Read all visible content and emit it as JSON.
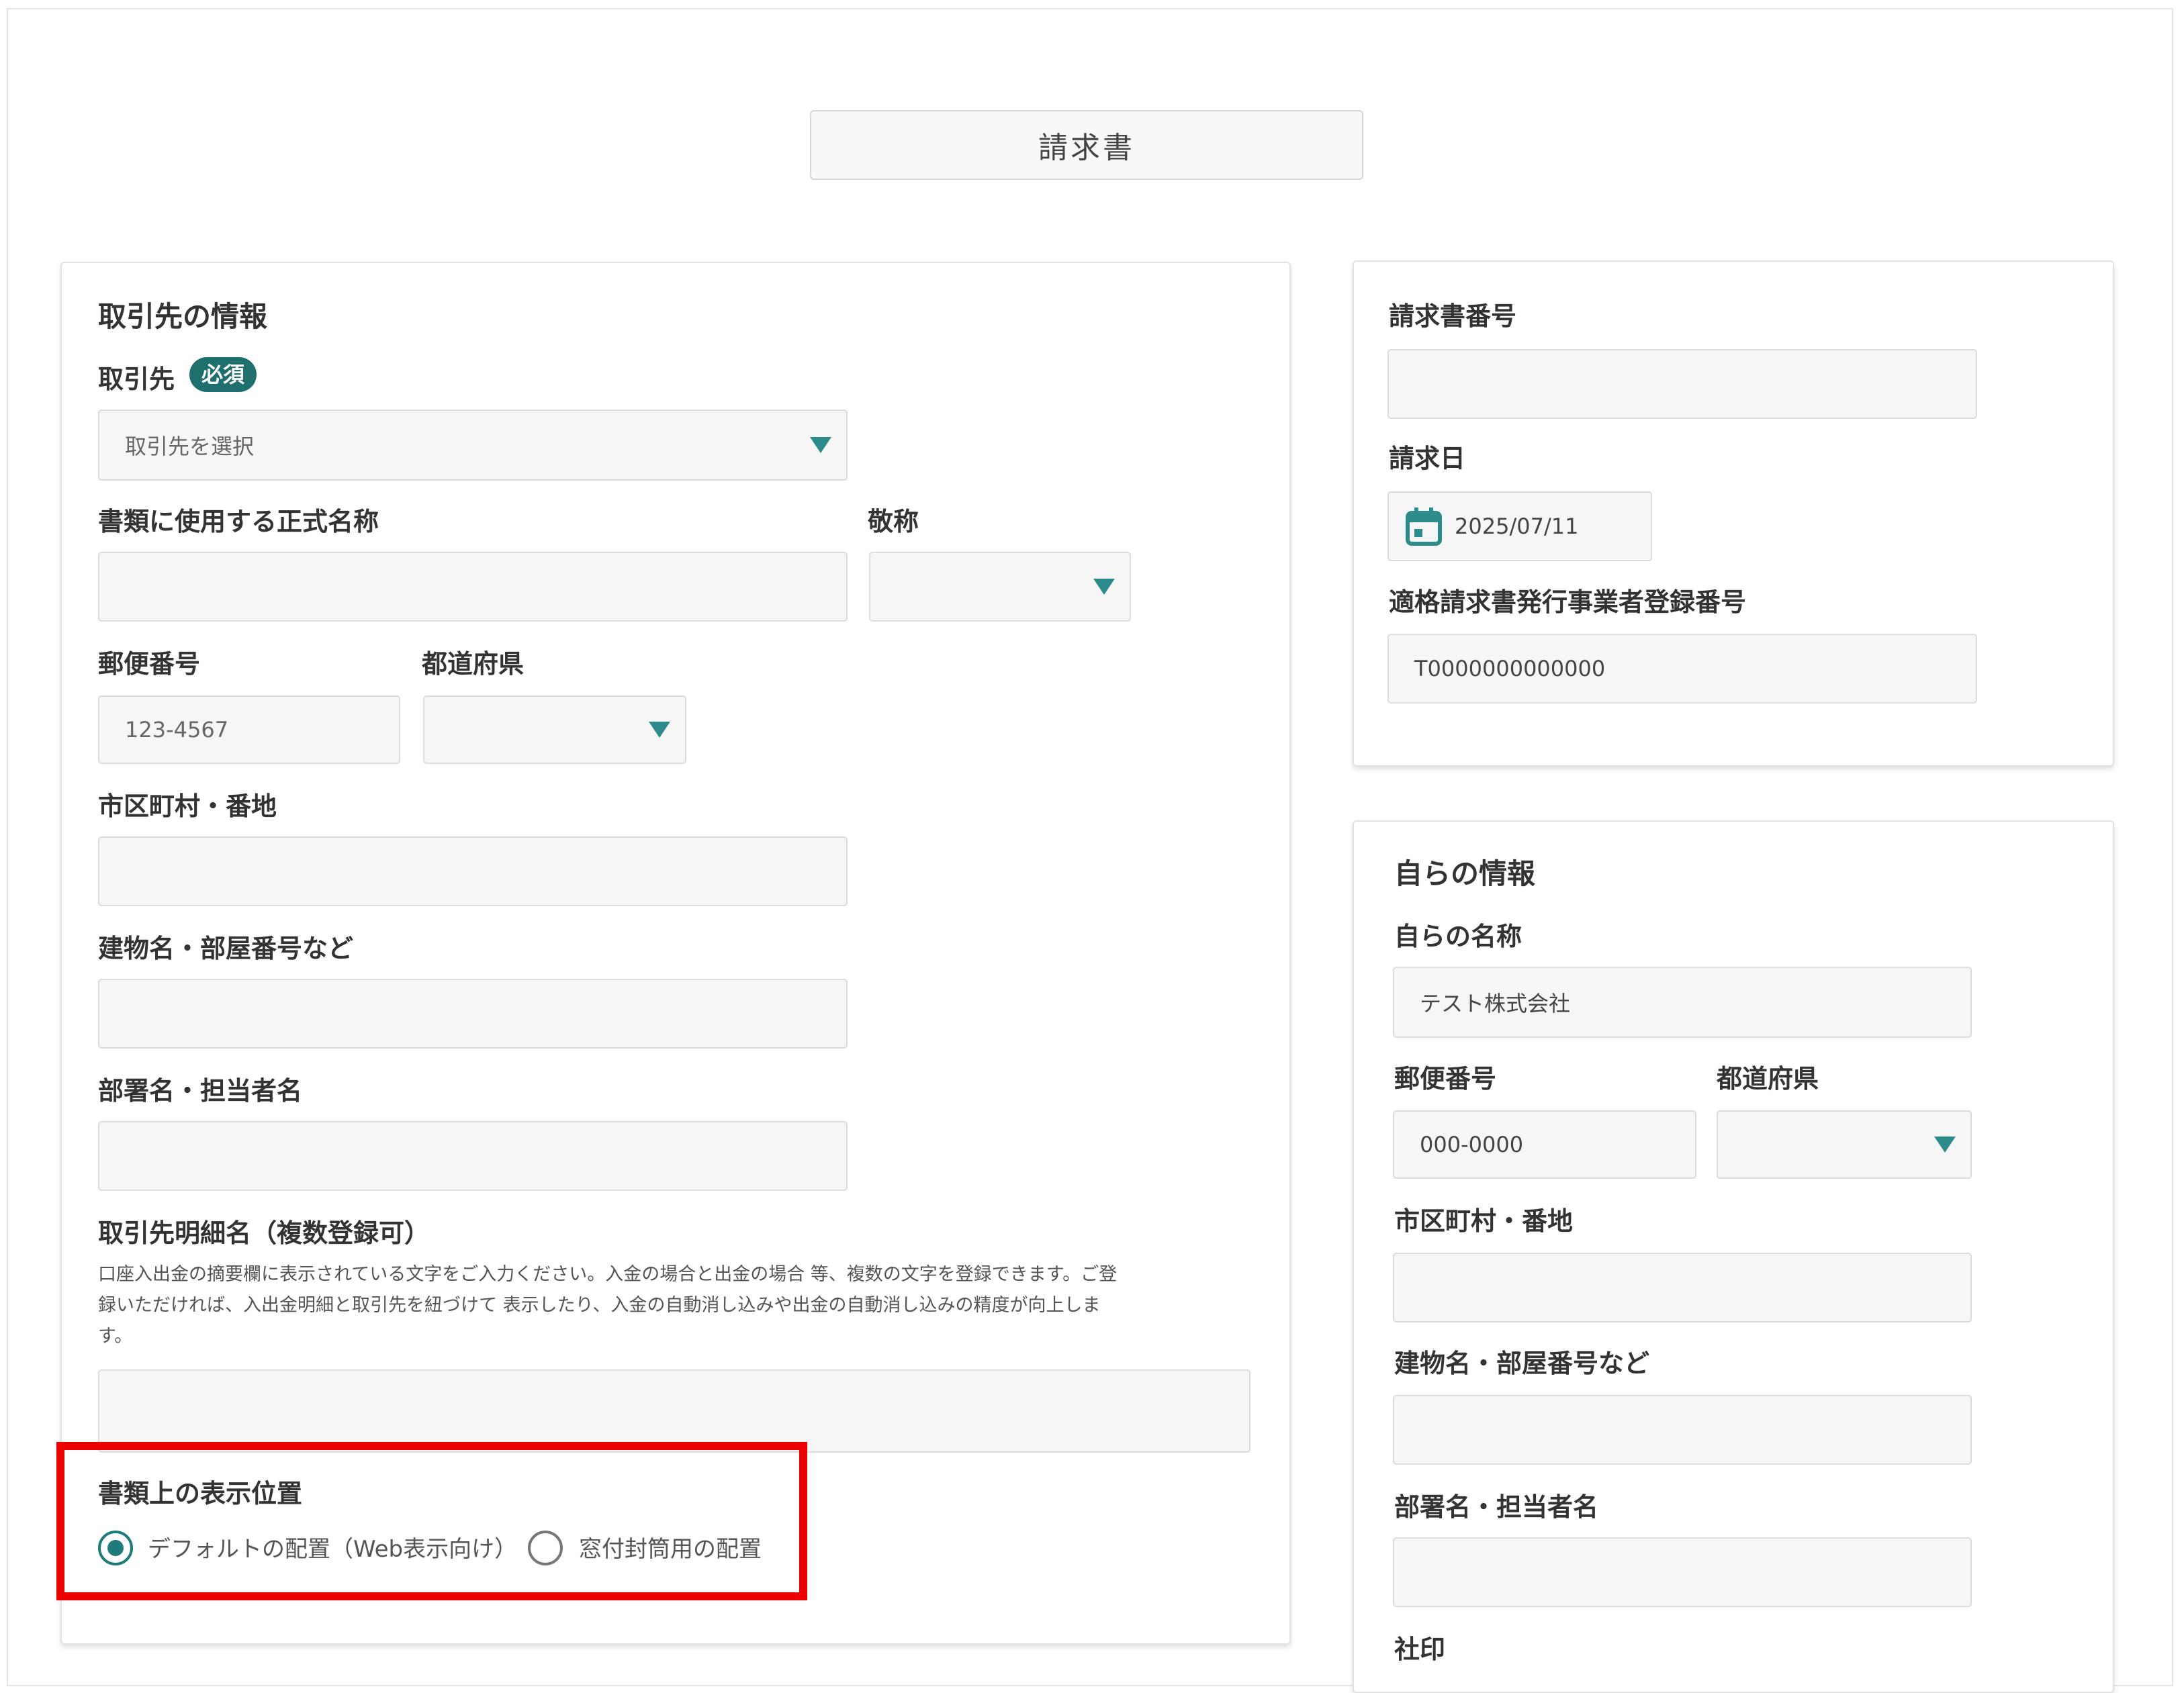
{
  "document_title": "請求書",
  "client": {
    "section_title": "取引先の情報",
    "client_label": "取引先",
    "required_badge": "必須",
    "client_placeholder": "取引先を選択",
    "official_name_label": "書類に使用する正式名称",
    "honorific_label": "敬称",
    "postal_label": "郵便番号",
    "postal_placeholder": "123-4567",
    "prefecture_label": "都道府県",
    "city_label": "市区町村・番地",
    "building_label": "建物名・部屋番号など",
    "department_label": "部署名・担当者名",
    "detail_name_label": "取引先明細名（複数登録可）",
    "detail_help_lines": [
      "口座入出金の摘要欄に表示されている文字をご入力ください。入金の場合と出金の場合 等、複数の文字を登録できます。ご登",
      "録いただければ、入出金明細と取引先を紐づけて 表示したり、入金の自動消し込みや出金の自動消し込みの精度が向上しま",
      "す。"
    ],
    "display_position_label": "書類上の表示位置",
    "radio_default_label": "デフォルトの配置（Web表示向け）",
    "radio_window_label": "窓付封筒用の配置",
    "radio_selected": "default"
  },
  "invoice": {
    "number_label": "請求書番号",
    "date_label": "請求日",
    "date_value": "2025/07/11",
    "registration_label": "適格請求書発行事業者登録番号",
    "registration_value": "T0000000000000"
  },
  "own": {
    "section_title": "自らの情報",
    "name_label": "自らの名称",
    "name_value": "テスト株式会社",
    "postal_label": "郵便番号",
    "postal_value": "000-0000",
    "prefecture_label": "都道府県",
    "city_label": "市区町村・番地",
    "building_label": "建物名・部屋番号など",
    "department_label": "部署名・担当者名",
    "seal_label": "社印"
  },
  "colors": {
    "accent": "#2e8b8b",
    "badge": "#1f6f6f",
    "highlight": "#ee0000"
  }
}
